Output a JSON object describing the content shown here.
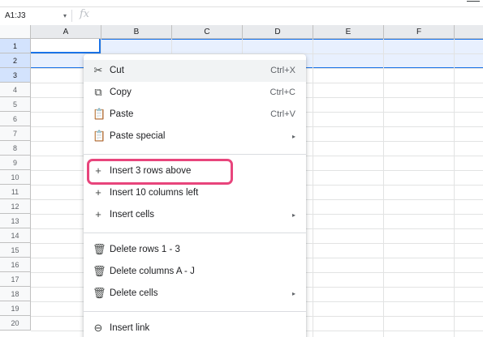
{
  "formula_bar": {
    "name_box": "A1:J3",
    "name_box_caret": "▾",
    "fx_label": "fx"
  },
  "columns": [
    "A",
    "B",
    "C",
    "D",
    "E",
    "F"
  ],
  "rows": [
    "1",
    "2",
    "3",
    "4",
    "5",
    "6",
    "7",
    "8",
    "9",
    "10",
    "11",
    "12",
    "13",
    "14",
    "15",
    "16",
    "17",
    "18",
    "19",
    "20"
  ],
  "selection": {
    "rows": [
      "1",
      "2",
      "3"
    ],
    "accent_color": "#1a73e8"
  },
  "context_menu": {
    "items": [
      {
        "icon": "scissors-icon",
        "glyph": "✂",
        "label": "Cut",
        "shortcut": "Ctrl+X"
      },
      {
        "icon": "copy-icon",
        "glyph": "⧉",
        "label": "Copy",
        "shortcut": "Ctrl+C"
      },
      {
        "icon": "clipboard-icon",
        "glyph": "📋",
        "label": "Paste",
        "shortcut": "Ctrl+V"
      },
      {
        "icon": "clipboard-icon",
        "glyph": "📋",
        "label": "Paste special",
        "submenu": "▸"
      },
      {
        "icon": "plus-icon",
        "glyph": "+",
        "label": "Insert 3 rows above"
      },
      {
        "icon": "plus-icon",
        "glyph": "+",
        "label": "Insert 10 columns left"
      },
      {
        "icon": "plus-icon",
        "glyph": "+",
        "label": "Insert cells",
        "submenu": "▸"
      },
      {
        "icon": "trash-icon",
        "glyph": "🗑",
        "label": "Delete rows 1 - 3"
      },
      {
        "icon": "trash-icon",
        "glyph": "🗑",
        "label": "Delete columns A - J"
      },
      {
        "icon": "trash-icon",
        "glyph": "🗑",
        "label": "Delete cells",
        "submenu": "▸"
      },
      {
        "icon": "link-icon",
        "glyph": "⊖",
        "label": "Insert link"
      }
    ],
    "highlight_color": "#e8457c"
  }
}
